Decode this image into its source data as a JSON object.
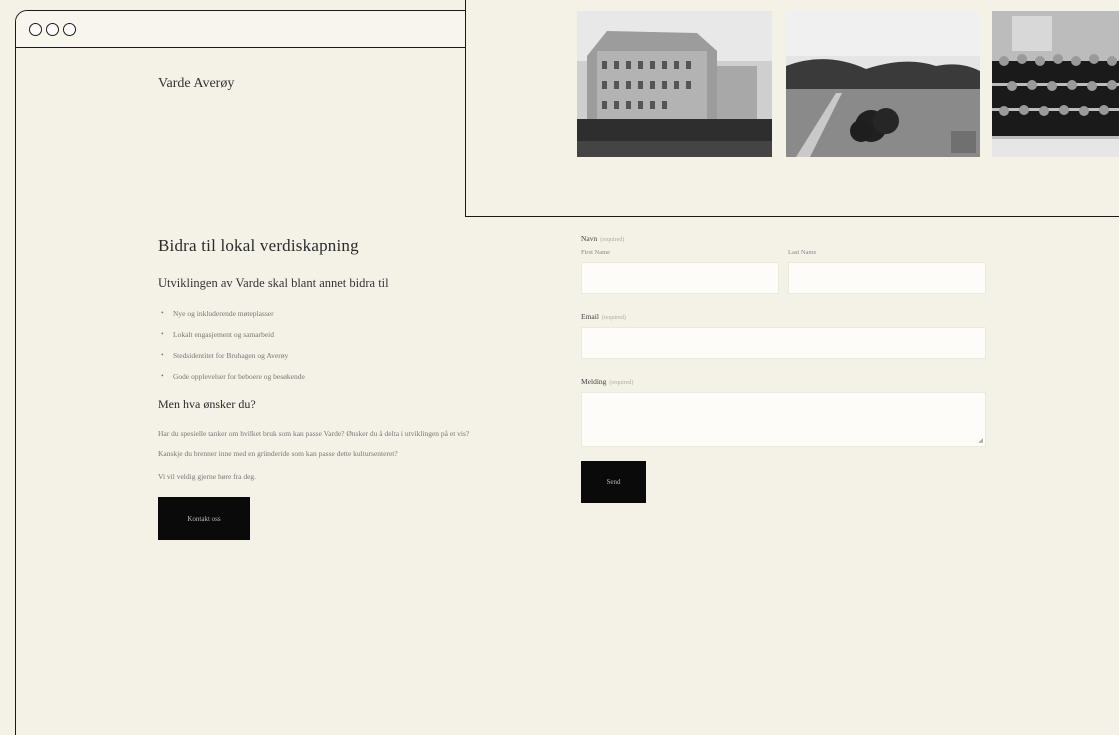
{
  "window": {
    "controls": [
      "circle",
      "circle",
      "circle"
    ]
  },
  "site": {
    "title": "Varde Averøy"
  },
  "gallery": {
    "photos": [
      "school-building-photo",
      "landscape-photo",
      "group-portrait-photo"
    ]
  },
  "content": {
    "heading": "Bidra til lokal verdiskapning",
    "subheading": "Utviklingen av Varde skal blant annet bidra til",
    "bullets": [
      "Nye og inkluderende møteplasser",
      "Lokalt engasjement og samarbeid",
      "Stedsidentitet for Bruhagen og Averøy",
      "Gode opplevelser for beboere og besøkende"
    ],
    "question": "Men hva ønsker du?",
    "paragraph": "Har du spesielle tanker om hvilket bruk som kan passe Varde? Ønsker du å delta i utviklingen på et vis? Kanskje du brenner inne med en gründeride som kan passe dette kultursenteret?",
    "paragraph2": "Vi vil veldig gjerne høre fra deg.",
    "contact_button": "Kontakt oss"
  },
  "form": {
    "name_label": "Navn",
    "required": "(required)",
    "first_name_label": "First Name",
    "last_name_label": "Last Name",
    "email_label": "Email",
    "message_label": "Melding",
    "send_button": "Send"
  }
}
